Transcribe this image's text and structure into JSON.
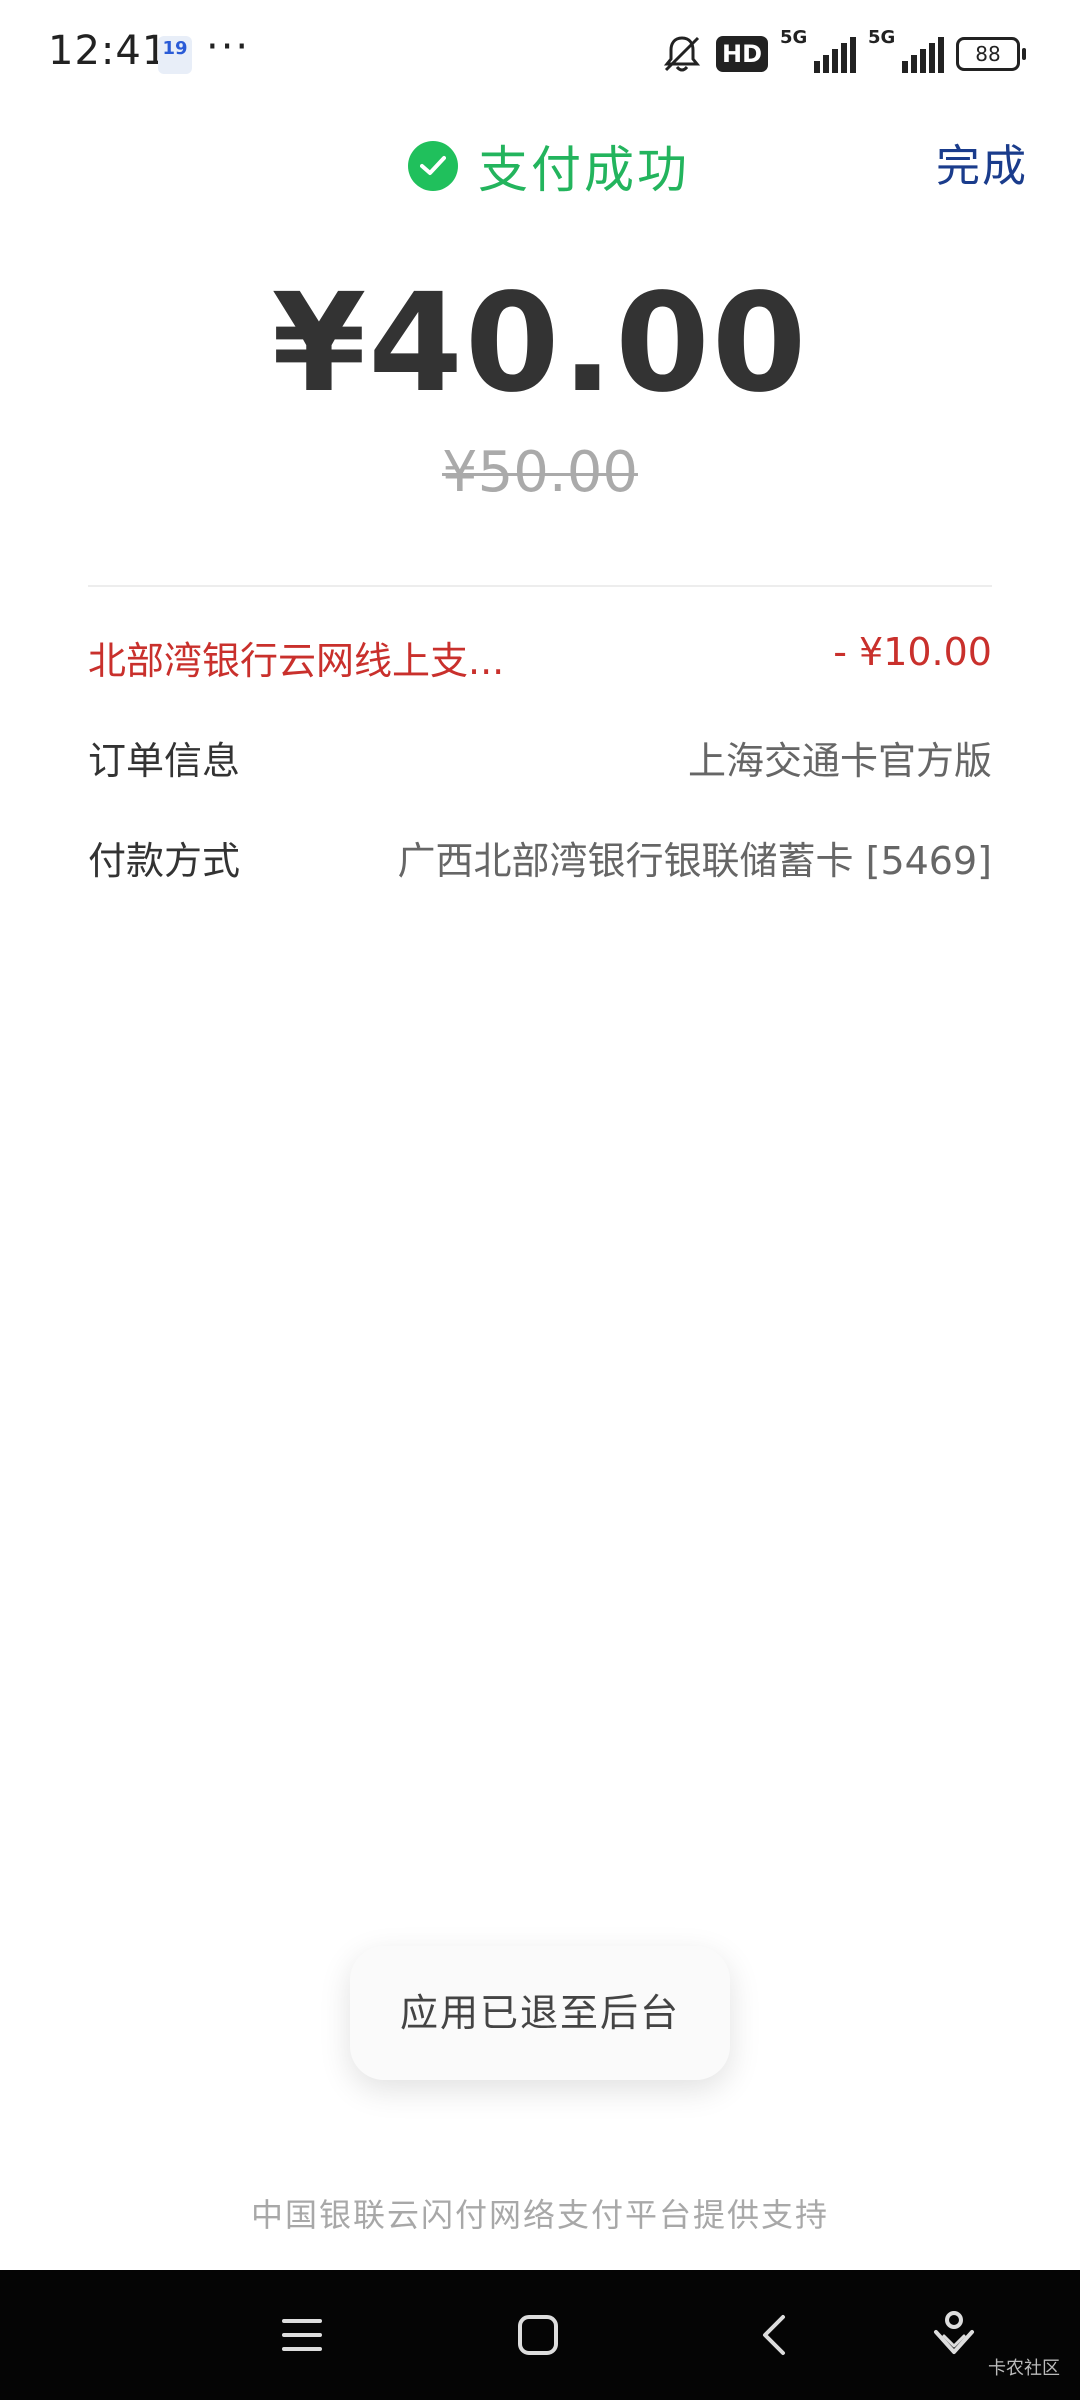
{
  "status_bar": {
    "time": "12:41",
    "calendar_day": "19",
    "more": "···",
    "hd_label": "HD",
    "network_1": "5G",
    "network_2": "5G",
    "battery": "88"
  },
  "header": {
    "status_text": "支付成功",
    "done_label": "完成",
    "status_color": "#23b45d"
  },
  "payment": {
    "amount": "¥40.00",
    "original_amount": "¥50.00"
  },
  "rows": {
    "discount_label": "北部湾银行云网线上支...",
    "discount_value": "- ¥10.00",
    "order_label": "订单信息",
    "order_value": "上海交通卡官方版",
    "method_label": "付款方式",
    "method_value": "广西北部湾银行银联储蓄卡 [5469]"
  },
  "toast": {
    "text": "应用已退至后台"
  },
  "footer": {
    "text": "中国银联云闪付网络支付平台提供支持"
  },
  "navbar": {
    "icons": [
      "menu-icon",
      "home-icon",
      "back-icon",
      "assistant-icon"
    ],
    "watermark": "卡农社区"
  }
}
